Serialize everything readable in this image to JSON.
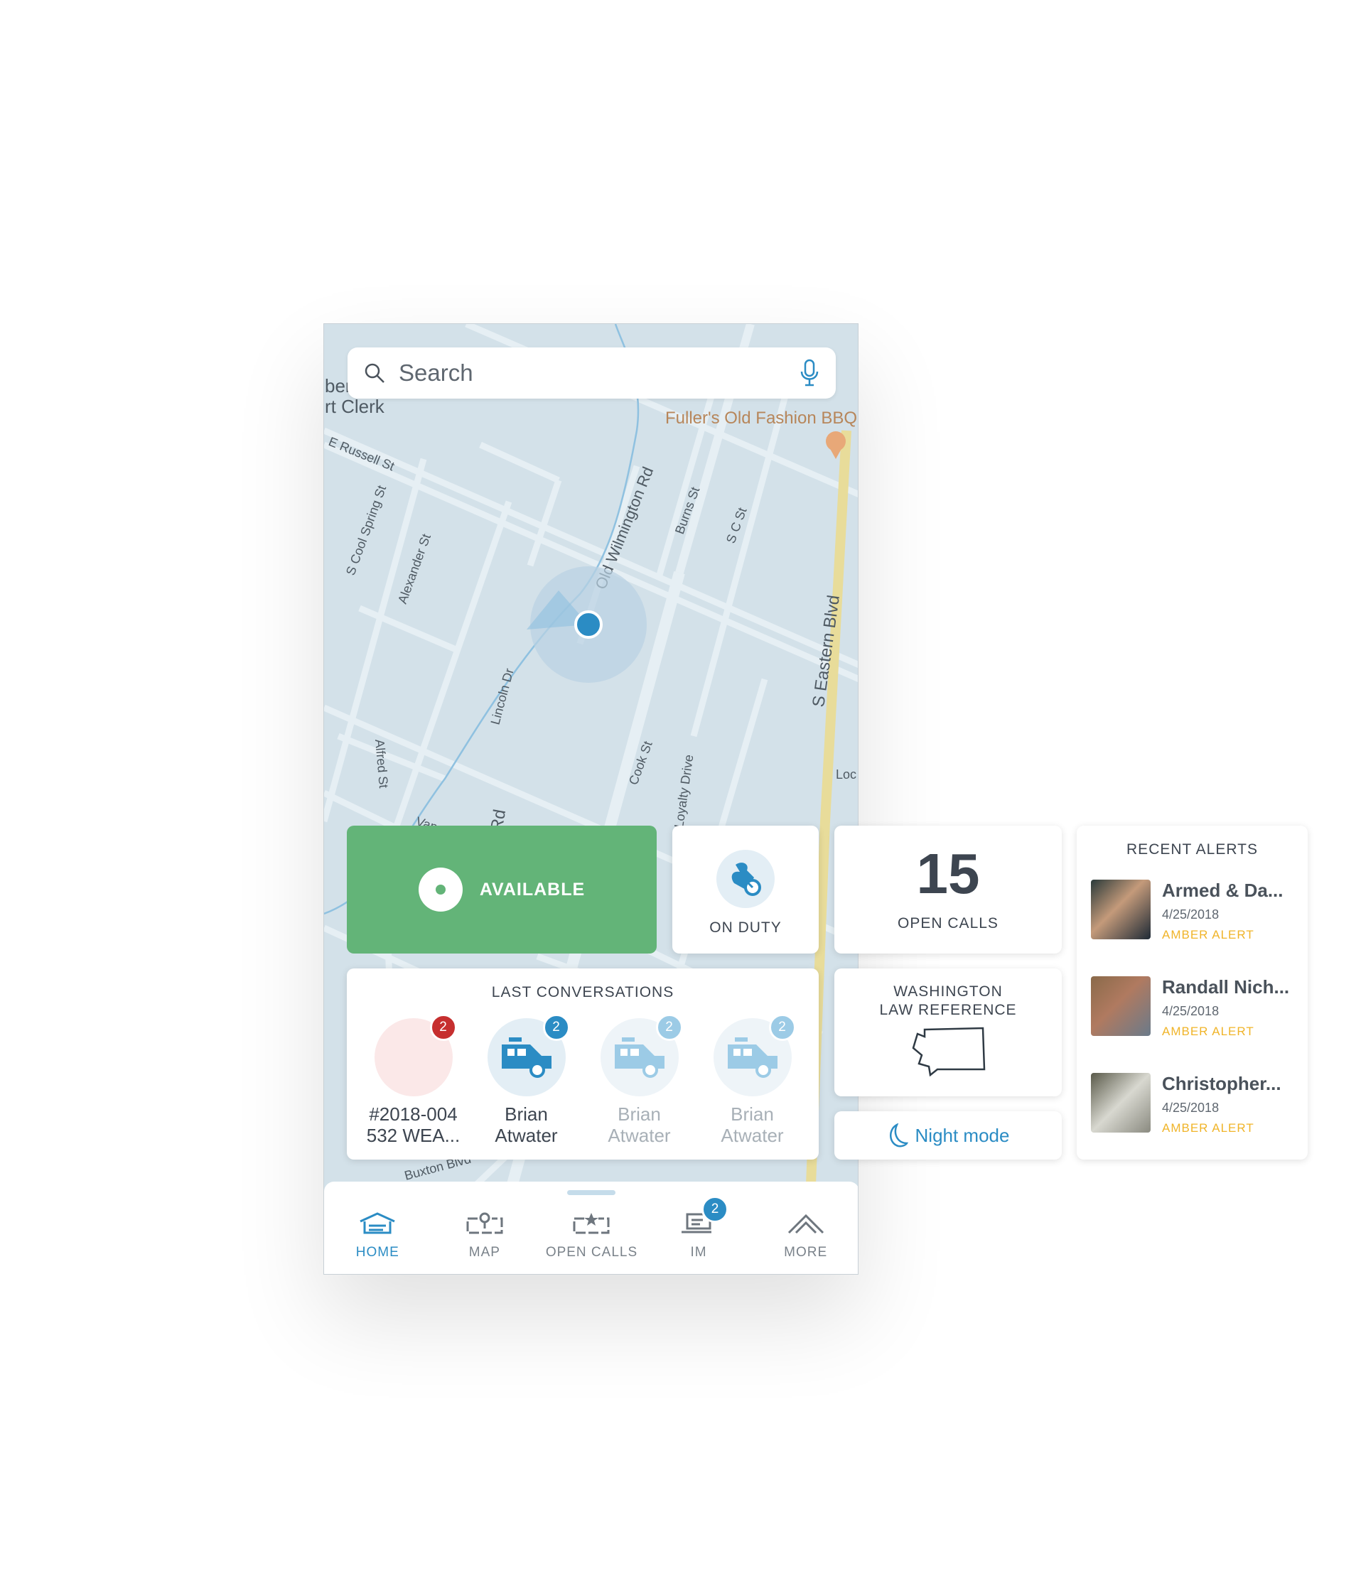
{
  "search": {
    "placeholder": "Search",
    "icon": "search-icon",
    "mic_icon": "microphone-icon"
  },
  "map": {
    "labels": [
      "ber",
      "rt Clerk",
      "Fuller's Old Fashion BBQ",
      "E Russell St",
      "S Cool Spring St",
      "Alexander St",
      "Old Wilmington Rd",
      "Burns St",
      "S C St",
      "S Eastern Blvd",
      "Lincoln Dr",
      "Alfred St",
      "Cook St",
      "Loyalty Drive",
      "Loc",
      "Rd",
      "Vance",
      "Buxton Blvd"
    ]
  },
  "status": {
    "available_label": "AVAILABLE",
    "color": "#63b478"
  },
  "duty": {
    "label": "ON DUTY"
  },
  "open_calls": {
    "count": "15",
    "label": "OPEN CALLS"
  },
  "conversations": {
    "title": "LAST CONVERSATIONS",
    "items": [
      {
        "line1": "#2018-004",
        "line2": "532 WEA...",
        "badge": "2"
      },
      {
        "line1": "Brian",
        "line2": "Atwater",
        "badge": "2"
      },
      {
        "line1": "Brian",
        "line2": "Atwater",
        "badge": "2"
      },
      {
        "line1": "Brian",
        "line2": "Atwater",
        "badge": "2"
      }
    ]
  },
  "law": {
    "line1": "WASHINGTON",
    "line2": "LAW REFERENCE"
  },
  "night": {
    "label": "Night mode"
  },
  "alerts": {
    "title": "RECENT ALERTS",
    "items": [
      {
        "name": "Armed & Da...",
        "date": "4/25/2018",
        "type": "AMBER ALERT"
      },
      {
        "name": "Randall Nich...",
        "date": "4/25/2018",
        "type": "AMBER ALERT"
      },
      {
        "name": "Christopher...",
        "date": "4/25/2018",
        "type": "AMBER ALERT"
      }
    ]
  },
  "nav": {
    "items": [
      {
        "label": "HOME"
      },
      {
        "label": "MAP"
      },
      {
        "label": "OPEN CALLS"
      },
      {
        "label": "IM",
        "badge": "2"
      },
      {
        "label": "MORE"
      }
    ],
    "accent": "#2b8cc4"
  }
}
